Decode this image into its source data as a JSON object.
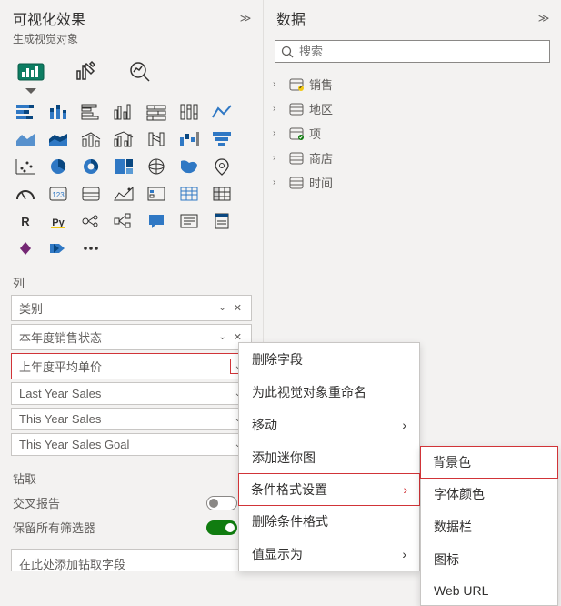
{
  "viz_panel": {
    "title": "可视化效果",
    "subtitle": "生成视觉对象",
    "columns_label": "列",
    "fields": [
      {
        "label": "类别",
        "closable": true,
        "dropdown": true
      },
      {
        "label": "本年度销售状态",
        "closable": true,
        "dropdown": true
      },
      {
        "label": "上年度平均单价",
        "closable": false,
        "dropdown": true,
        "highlight": true
      },
      {
        "label": "Last Year Sales",
        "closable": false,
        "dropdown": true
      },
      {
        "label": "This Year Sales",
        "closable": false,
        "dropdown": true
      },
      {
        "label": "This Year Sales Goal",
        "closable": false,
        "dropdown": true
      }
    ],
    "drill": {
      "section": "钻取",
      "cross_report": "交叉报告",
      "cross_toggle_label": "关",
      "keep_filters": "保留所有筛选器",
      "keep_toggle_label": "开",
      "drop_placeholder": "在此处添加钻取字段"
    }
  },
  "data_panel": {
    "title": "数据",
    "search_placeholder": "搜索",
    "tables": [
      {
        "name": "销售",
        "badge": "up"
      },
      {
        "name": "地区"
      },
      {
        "name": "项",
        "badge": "check"
      },
      {
        "name": "商店"
      },
      {
        "name": "时间"
      }
    ]
  },
  "context_menu_1": [
    {
      "label": "删除字段"
    },
    {
      "label": "为此视觉对象重命名"
    },
    {
      "label": "移动",
      "sub": true
    },
    {
      "label": "添加迷你图"
    },
    {
      "label": "条件格式设置",
      "sub": true,
      "highlight": true
    },
    {
      "label": "删除条件格式"
    },
    {
      "label": "值显示为",
      "sub": true
    }
  ],
  "context_menu_2": [
    {
      "label": "背景色",
      "highlight": true
    },
    {
      "label": "字体颜色"
    },
    {
      "label": "数据栏"
    },
    {
      "label": "图标"
    },
    {
      "label": "Web URL"
    }
  ]
}
